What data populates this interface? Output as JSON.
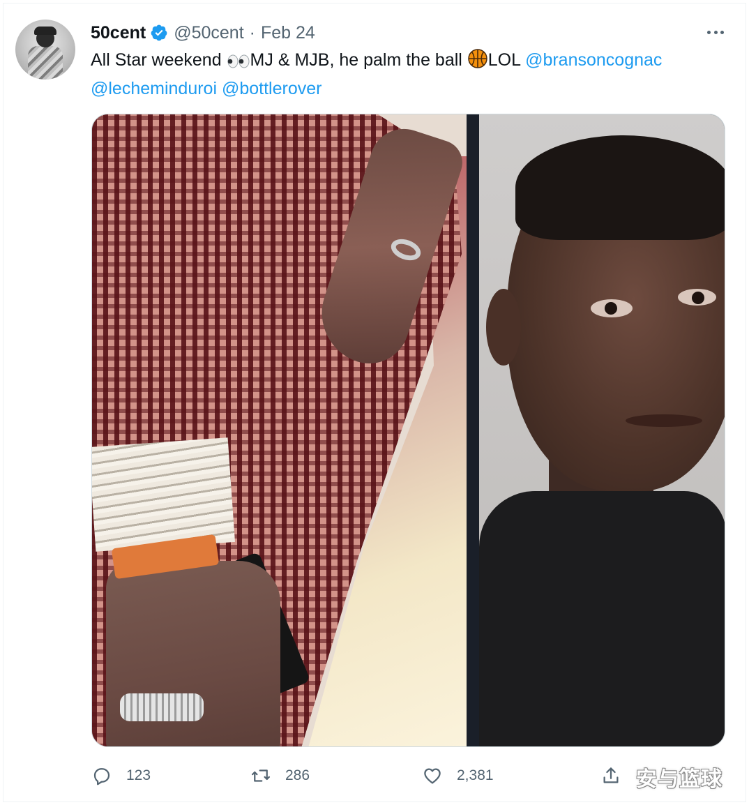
{
  "tweet": {
    "display_name": "50cent",
    "handle": "@50cent",
    "separator": "·",
    "date": "Feb 24",
    "text_part1": "All Star weekend ",
    "emoji_eyes": "👀",
    "text_part2": "MJ & MJB, he palm the ball ",
    "emoji_ball": "🏀",
    "text_part3": "LOL ",
    "mention_1": "@bransoncognac",
    "mention_2": "@lecheminduroi",
    "mention_3": "@bottlerover"
  },
  "icons": {
    "verified": "verified-badge-icon",
    "more": "more-options-icon",
    "reply": "reply-icon",
    "retweet": "retweet-icon",
    "like": "heart-icon",
    "share": "share-icon"
  },
  "actions": {
    "reply_count": "123",
    "retweet_count": "286",
    "like_count": "2,381"
  },
  "watermark": "安与篮球",
  "colors": {
    "link": "#1d9bf0",
    "secondary_text": "#536471",
    "primary_text": "#0f1419",
    "verified": "#1d9bf0",
    "wristband": "#e07a3a"
  }
}
